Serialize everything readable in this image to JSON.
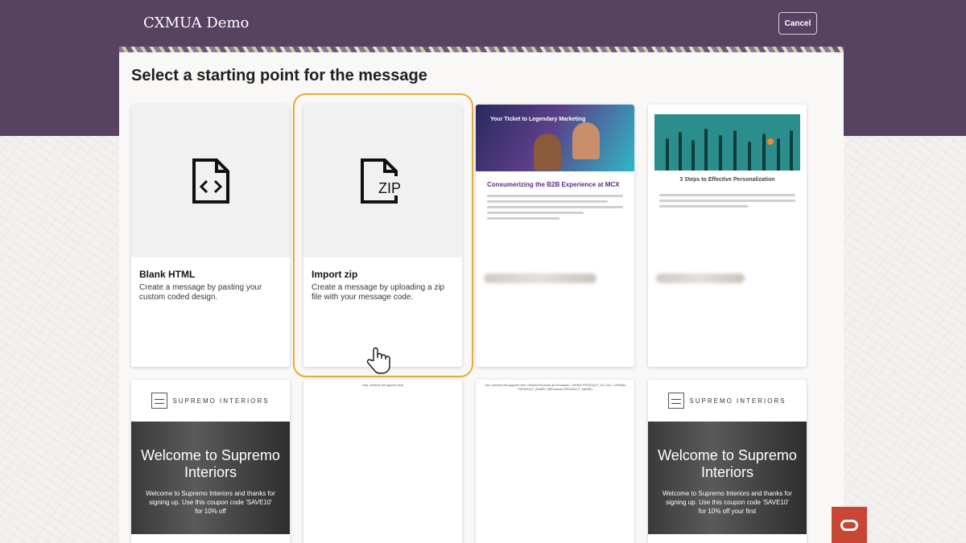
{
  "header": {
    "app_title": "CXMUA Demo",
    "cancel_label": "Cancel"
  },
  "panel": {
    "heading": "Select a starting point for the message"
  },
  "cards": [
    {
      "title": "Blank HTML",
      "description": "Create a message by pasting your custom coded design.",
      "icon": "code-file-icon"
    },
    {
      "title": "Import zip",
      "description": "Create a message by uploading a zip file with your message code.",
      "icon": "zip-file-icon",
      "icon_text": "ZIP",
      "selected": true
    },
    {
      "title": "my test landing page...",
      "blurred": true,
      "preview": {
        "hero_text": "Your Ticket to Legendary Marketing",
        "heading": "Consumerizing the B2B Experience at MCX"
      }
    },
    {
      "title": "Wren demo email",
      "blurred": true,
      "preview": {
        "heading": "3 Steps to Effective Personalization"
      }
    }
  ],
  "bottom_cards": [
    {
      "brand": "SUPREMO INTERIORS",
      "welcome_title": "Welcome to Supremo Interiors",
      "welcome_text": "Welcome to Supremo Interiors and thanks for signing up. Use this coupon code 'SAVE10' for 10% off"
    },
    {
      "placeholder_text": "Your content will appear here"
    },
    {
      "placeholder_text": "Your content will appear here <#Vars:Products as Products> <#Filter PRODUCT_ID=111> <#Fields PRODUCT_NAME> ${Products.PRODUCT_NAME}"
    },
    {
      "brand": "SUPREMO INTERIORS",
      "welcome_title": "Welcome to Supremo Interiors",
      "welcome_text": "Welcome to Supremo Interiors and thanks for signing up. Use this coupon code 'SAVE10' for 10% off your first"
    }
  ],
  "colors": {
    "header_bg": "#574261",
    "selected_ring": "#e6a93c",
    "oracle_red": "#c74634"
  }
}
